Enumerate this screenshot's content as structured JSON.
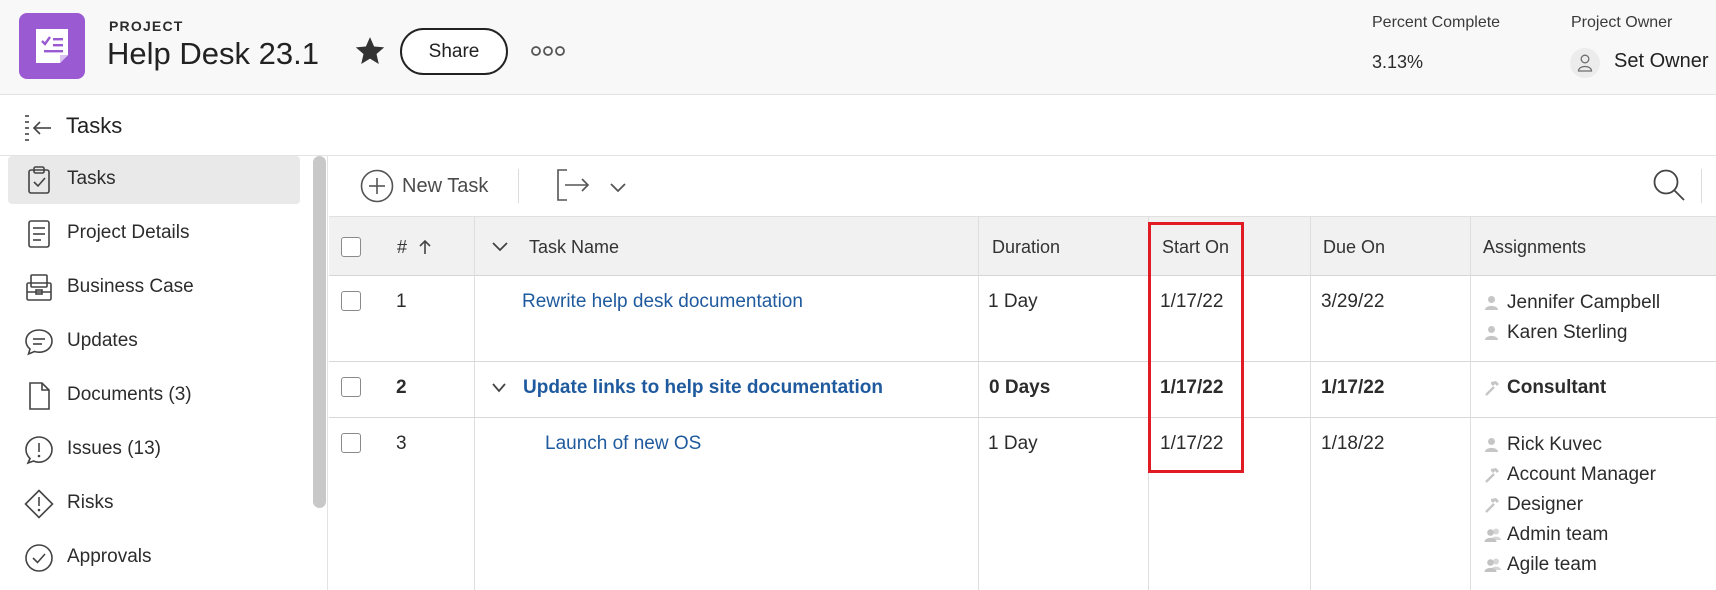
{
  "header": {
    "project_label": "PROJECT",
    "title": "Help Desk 23.1",
    "share_label": "Share",
    "percent_complete_label": "Percent Complete",
    "percent_complete_value": "3.13%",
    "owner_label": "Project Owner",
    "owner_value": "Set Owner"
  },
  "subheader": {
    "title": "Tasks"
  },
  "sidebar": {
    "items": [
      {
        "label": "Tasks",
        "icon": "clipboard-check-icon",
        "active": true
      },
      {
        "label": "Project Details",
        "icon": "document-lines-icon"
      },
      {
        "label": "Business Case",
        "icon": "briefcase-stack-icon"
      },
      {
        "label": "Updates",
        "icon": "chat-bubble-icon"
      },
      {
        "label": "Documents (3)",
        "icon": "file-icon"
      },
      {
        "label": "Issues (13)",
        "icon": "alert-circle-icon"
      },
      {
        "label": "Risks",
        "icon": "alert-diamond-icon"
      },
      {
        "label": "Approvals",
        "icon": "check-circle-icon"
      }
    ]
  },
  "toolbar": {
    "new_task_label": "New Task"
  },
  "table": {
    "columns": {
      "number": "#",
      "task_name": "Task Name",
      "duration": "Duration",
      "start_on": "Start On",
      "due_on": "Due On",
      "assignments": "Assignments"
    },
    "rows": [
      {
        "number": "1",
        "task_name": "Rewrite help desk documentation",
        "duration": "1 Day",
        "start_on": "1/17/22",
        "due_on": "3/29/22",
        "assignments": [
          {
            "name": "Jennifer Campbell",
            "type": "user-icon"
          },
          {
            "name": "Karen Sterling",
            "type": "user-icon"
          }
        ]
      },
      {
        "number": "2",
        "task_name": "Update links to help site documentation",
        "duration": "0 Days",
        "start_on": "1/17/22",
        "due_on": "1/17/22",
        "assignments": [
          {
            "name": "Consultant",
            "type": "role-hammer-icon"
          }
        ]
      },
      {
        "number": "3",
        "task_name": "Launch of new OS",
        "duration": "1 Day",
        "start_on": "1/17/22",
        "due_on": "1/18/22",
        "assignments": [
          {
            "name": "Rick Kuvec",
            "type": "user-icon"
          },
          {
            "name": "Account Manager",
            "type": "role-hammer-icon"
          },
          {
            "name": "Designer",
            "type": "role-hammer-icon"
          },
          {
            "name": "Admin team",
            "type": "team-icon"
          },
          {
            "name": "Agile team",
            "type": "team-icon"
          }
        ]
      }
    ]
  },
  "colors": {
    "brand_purple": "#9a5ad2",
    "link_blue": "#1f5a9e",
    "highlight_red": "#e11b24"
  }
}
